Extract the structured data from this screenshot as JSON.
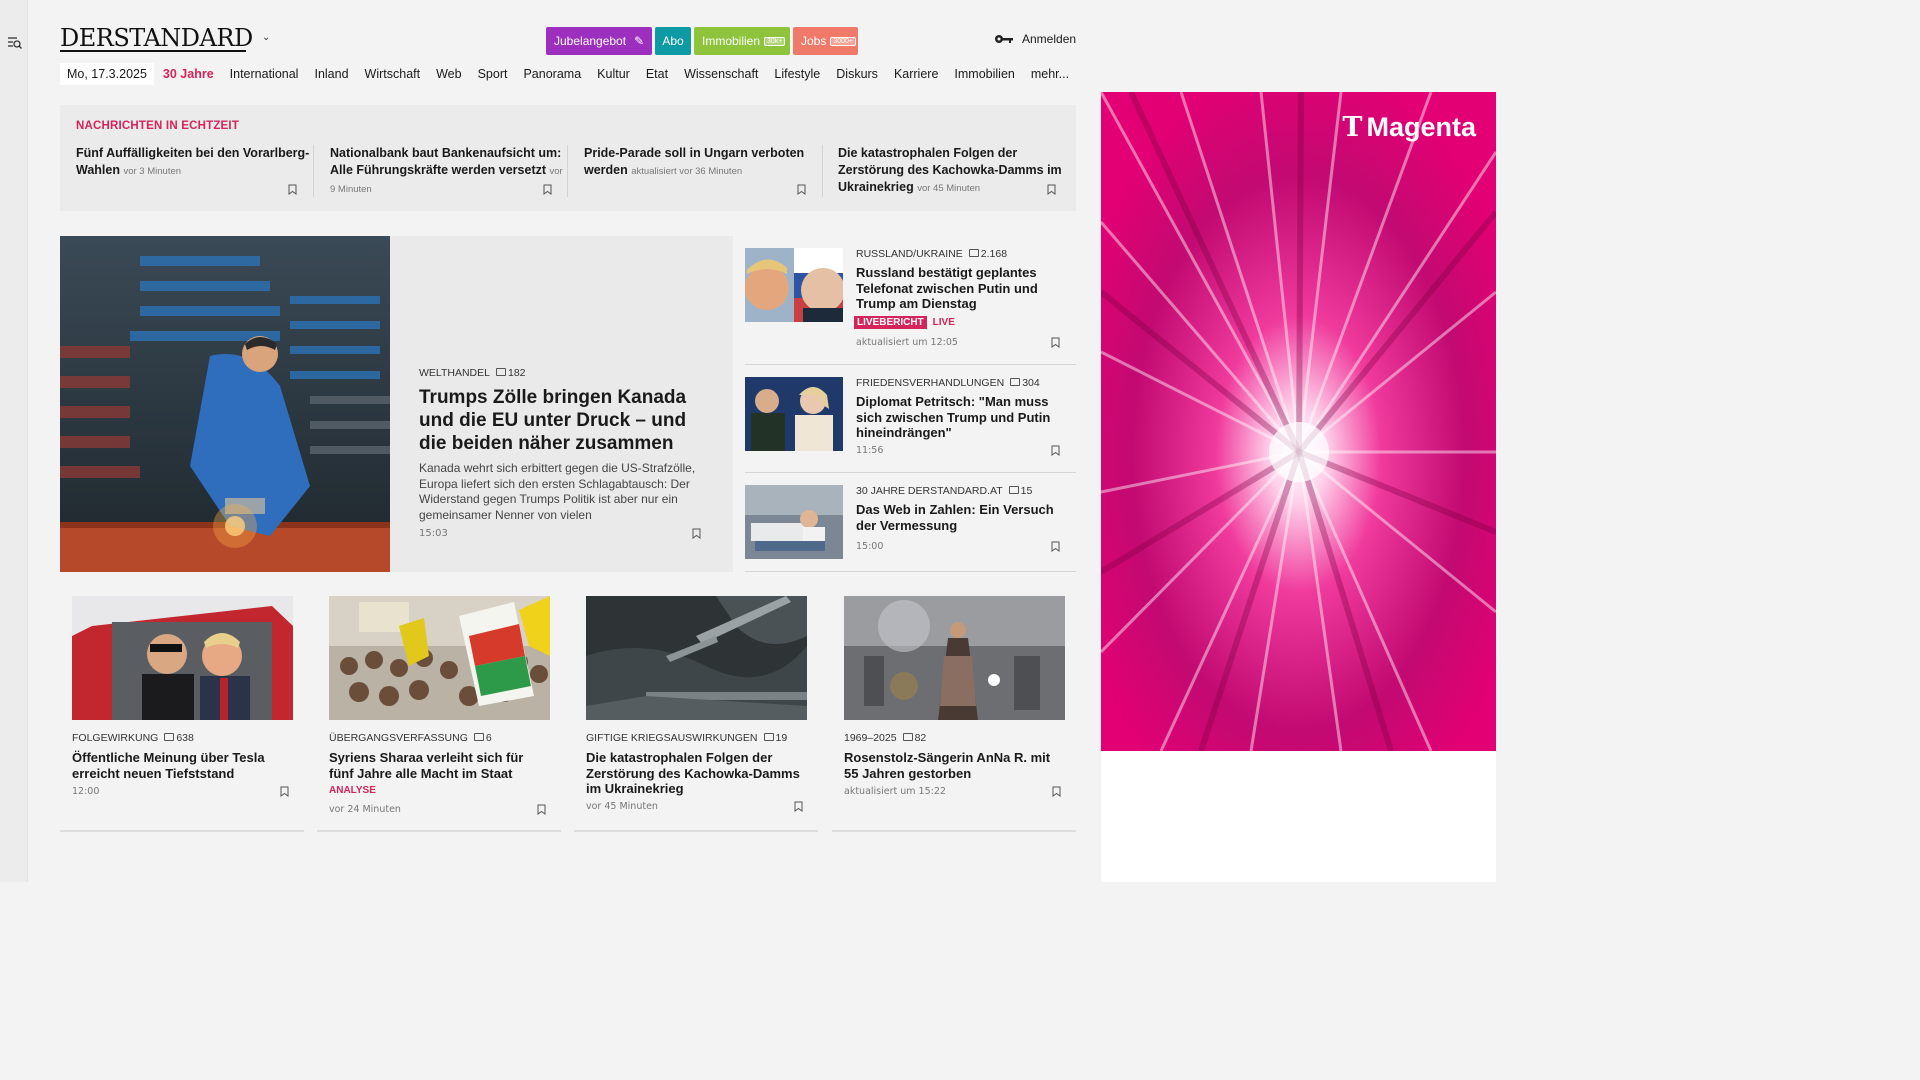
{
  "header": {
    "logo": "DERSTANDARD",
    "pills": [
      {
        "label": "Jubelangebot",
        "icon": "party-popper-icon",
        "color": "#9c2fbd"
      },
      {
        "label": "Abo",
        "color": "#0e9aa4"
      },
      {
        "label": "Immobilien",
        "badge": "30k+",
        "color": "#8dc43c"
      },
      {
        "label": "Jobs",
        "badge": "3000+",
        "color": "#f07a6a"
      }
    ],
    "login": "Anmelden"
  },
  "nav": {
    "date": "Mo, 17.3.2025",
    "items": [
      "30 Jahre",
      "International",
      "Inland",
      "Wirtschaft",
      "Web",
      "Sport",
      "Panorama",
      "Kultur",
      "Etat",
      "Wissenschaft",
      "Lifestyle",
      "Diskurs",
      "Karriere",
      "Immobilien",
      "mehr..."
    ]
  },
  "ticker": {
    "title": "NACHRICHTEN IN ECHTZEIT",
    "items": [
      {
        "headline": "Fünf Auffälligkeiten bei den Vorarlberg-Wahlen",
        "time": "vor 3 Minuten"
      },
      {
        "headline": "Nationalbank baut Bankenaufsicht um: Alle Führungskräfte werden versetzt",
        "time": "vor 9 Minuten"
      },
      {
        "headline": "Pride-Parade soll in Ungarn verboten werden",
        "time": "aktualisiert vor 36 Minuten"
      },
      {
        "headline": "Die katastrophalen Folgen der Zerstörung des Kachowka-Damms im Ukrainekrieg",
        "time": "vor 45 Minuten"
      }
    ]
  },
  "hero": {
    "kicker": "WELTHANDEL",
    "comments": "182",
    "title": "Trumps Zölle bringen Kanada und die EU unter Druck – und die beiden näher zusammen",
    "teaser": "Kanada wehrt sich erbittert gegen die US-Strafzölle, Europa liefert sich den ersten Schlagabtausch: Der Widerstand gegen Trumps Politik ist aber nur ein gemeinsamer Nenner von vielen",
    "time": "15:03"
  },
  "side": [
    {
      "kicker": "RUSSLAND/UKRAINE",
      "comments": "2.168",
      "title": "Russland bestätigt geplantes Telefonat zwischen Putin und Trump am Dienstag",
      "badge": "LIVEBERICHT",
      "live": "LIVE",
      "meta": "aktualisiert um 12:05"
    },
    {
      "kicker": "FRIEDENSVERHANDLUNGEN",
      "comments": "304",
      "title": "Diplomat Petritsch: \"Man muss sich zwischen Trump und Putin hineindrängen\"",
      "meta": "11:56"
    },
    {
      "kicker": "30 JAHRE DERSTANDARD.AT",
      "comments": "15",
      "title": "Das Web in Zahlen: Ein Versuch der Vermessung",
      "meta": "15:00"
    }
  ],
  "cards": [
    {
      "kicker": "FOLGEWIRKUNG",
      "comments": "638",
      "title": "Öffentliche Meinung über Tesla erreicht neuen Tiefststand",
      "meta": "12:00"
    },
    {
      "kicker": "ÜBERGANGSVERFASSUNG",
      "comments": "6",
      "title": "Syriens Sharaa verleiht sich für fünf Jahre alle Macht im Staat",
      "tag": "ANALYSE",
      "meta": "vor 24 Minuten"
    },
    {
      "kicker": "GIFTIGE KRIEGSAUSWIRKUNGEN",
      "comments": "19",
      "title": "Die katastrophalen Folgen der Zerstörung des Kachowka-Damms im Ukrainekrieg",
      "meta": "vor 45 Minuten"
    },
    {
      "kicker": "1969–2025",
      "comments": "82",
      "title": "Rosenstolz-Sängerin AnNa R. mit 55 Jahren gestorben",
      "meta": "aktualisiert um 15:22"
    }
  ],
  "ad": {
    "brand_mark": "T",
    "brand": "Magenta",
    "color": "#e20074"
  }
}
